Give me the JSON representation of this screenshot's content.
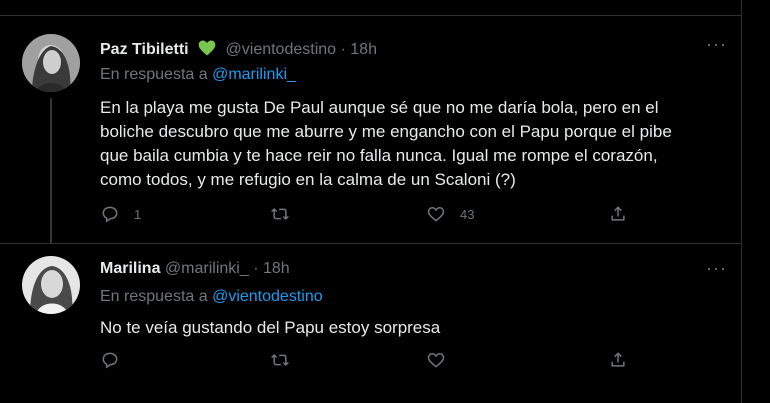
{
  "tweets": [
    {
      "name": "Paz Tibiletti",
      "badge_icon": "green-heart-icon",
      "handle": "@vientodestino",
      "dot": "·",
      "time": "18h",
      "reply_prefix": "En respuesta a",
      "reply_to": "@marilinki_",
      "text": "En la playa me gusta De Paul aunque sé que no me daría bola, pero en el\nboliche descubro que me aburre y me engancho con el Papu porque el pibe\nque baila cumbia y te hace reir no falla nunca. Igual me rompe el corazón,\ncomo todos, y me refugio en la calma de un Scaloni (?)",
      "replies": "1",
      "retweets": "",
      "likes": "43",
      "more": "···"
    },
    {
      "name": "Marilina",
      "handle": "@marilinki_",
      "dot": "·",
      "time": "18h",
      "reply_prefix": "En respuesta a",
      "reply_to": "@vientodestino",
      "text": "No te veía gustando del Papu estoy sorpresa",
      "replies": "",
      "retweets": "",
      "likes": "",
      "more": "···"
    }
  ],
  "colors": {
    "background": "#000000",
    "text": "#e7e9ea",
    "muted": "#71767b",
    "link": "#1d9bf0",
    "badge": "#7ac74f"
  },
  "icons": [
    "reply-icon",
    "retweet-icon",
    "like-icon",
    "share-icon",
    "more-icon"
  ]
}
